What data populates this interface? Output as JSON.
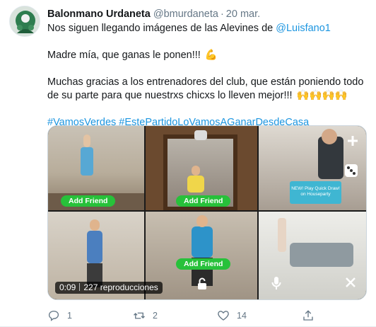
{
  "tweet": {
    "author_name": "Balonmano Urdaneta",
    "handle": "@bmurdaneta",
    "separator": "·",
    "date": "20 mar.",
    "line1_prefix": "Nos siguen llegando imágenes de las Alevines de ",
    "line1_mention": "@Luisfano1",
    "line2_text": "Madre mía, que ganas le ponen!!!",
    "line2_emoji": "💪",
    "line3_text": "Muchas gracias a los entrenadores del club, que están poniendo todo de su parte para que nuestrxs chicxs lo lleven mejor!!!",
    "line3_emoji": "🙌🙌🙌🙌",
    "hashtags": "#VamosVerdes #EstePartidoLoVamosAGanarDesdeCasa"
  },
  "media": {
    "add_friend_label": "Add Friend",
    "banner_text": "NEW! Play Quick Draw! on Houseparty",
    "time": "0:09",
    "views": "227 reproducciones"
  },
  "actions": {
    "reply_count": "1",
    "retweet_count": "2",
    "like_count": "14"
  },
  "colors": {
    "link": "#1b95e0",
    "muted": "#657786",
    "add_friend": "#27c13a"
  }
}
